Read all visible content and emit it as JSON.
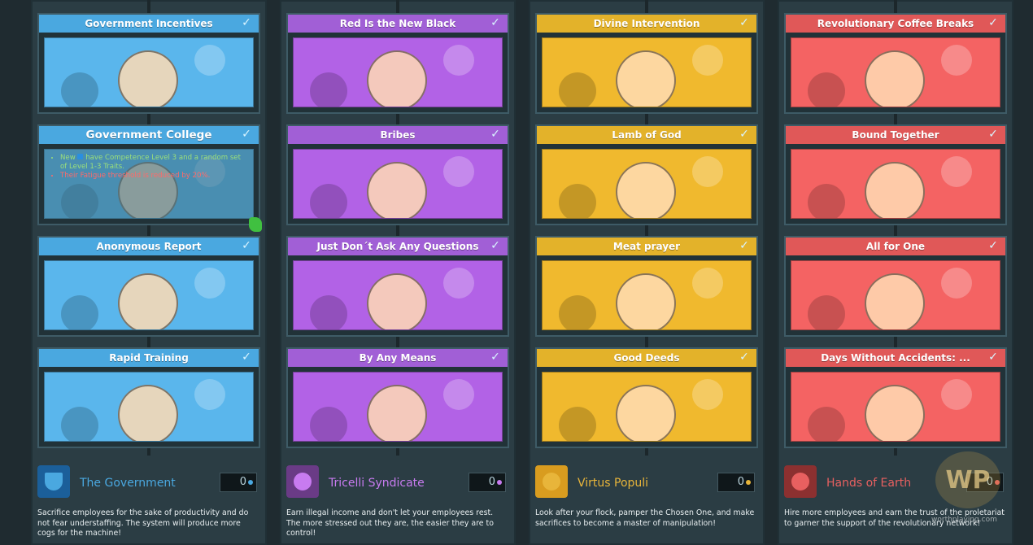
{
  "columns": [
    {
      "key": "gov",
      "header_color": "#4aa8e0",
      "art_color": "#5ab6ec",
      "cards": [
        {
          "title": "Government Incentives",
          "checked": true
        },
        {
          "title": "Government College",
          "checked": true,
          "tooltip": true
        },
        {
          "title": "Anonymous Report",
          "checked": true
        },
        {
          "title": "Rapid Training",
          "checked": true
        }
      ],
      "faction": {
        "name": "The Government",
        "count": "0",
        "color": "#4aa8e0",
        "emblem_icon": "shield-icon",
        "description": "Sacrifice employees for the sake of productivity and do not fear understaffing. The system will produce more cogs for the machine!"
      }
    },
    {
      "key": "tri",
      "header_color": "#a15fd6",
      "art_color": "#b262e6",
      "cards": [
        {
          "title": "Red Is the New Black",
          "checked": true
        },
        {
          "title": "Bribes",
          "checked": true
        },
        {
          "title": "Just Don´t Ask Any Questions",
          "checked": true
        },
        {
          "title": "By Any Means",
          "checked": true
        }
      ],
      "faction": {
        "name": "Tricelli Syndicate",
        "count": "0",
        "color": "#c87bf0",
        "emblem_icon": "rose-icon",
        "description": "Earn illegal income and don't let your employees rest. The more stressed out they are, the easier they are to control!"
      }
    },
    {
      "key": "vir",
      "header_color": "#e3b22a",
      "art_color": "#f0b92e",
      "cards": [
        {
          "title": "Divine Intervention",
          "checked": true
        },
        {
          "title": "Lamb of God",
          "checked": true
        },
        {
          "title": "Meat prayer",
          "checked": true
        },
        {
          "title": "Good Deeds",
          "checked": true
        }
      ],
      "faction": {
        "name": "Virtus Populi",
        "count": "0",
        "color": "#e8b53a",
        "emblem_icon": "cross-book-icon",
        "description": "Look after your flock, pamper the Chosen One, and make sacrifices to become a master of manipulation!"
      }
    },
    {
      "key": "hoe",
      "header_color": "#e05858",
      "art_color": "#f46363",
      "cards": [
        {
          "title": "Revolutionary Coffee Breaks",
          "checked": true
        },
        {
          "title": "Bound Together",
          "checked": true
        },
        {
          "title": "All for One",
          "checked": true
        },
        {
          "title": "Days Without Accidents: ...",
          "checked": true
        }
      ],
      "faction": {
        "name": "Hands of Earth",
        "count": "0",
        "color": "#e86060",
        "emblem_icon": "globe-hands-icon",
        "description": "Hire more employees and earn the trust of the proletariat to garner the support of the revolutionary network!"
      }
    }
  ],
  "tooltip": {
    "line1_a": "New",
    "line1_b": "have Competence Level 3 and a random set of Level 1-3 Traits.",
    "line2": "Their Fatigue threshold is reduced by 20%."
  },
  "check_glyph": "✓",
  "watermark": {
    "logo": "WP",
    "text": "worthplaying.com"
  }
}
